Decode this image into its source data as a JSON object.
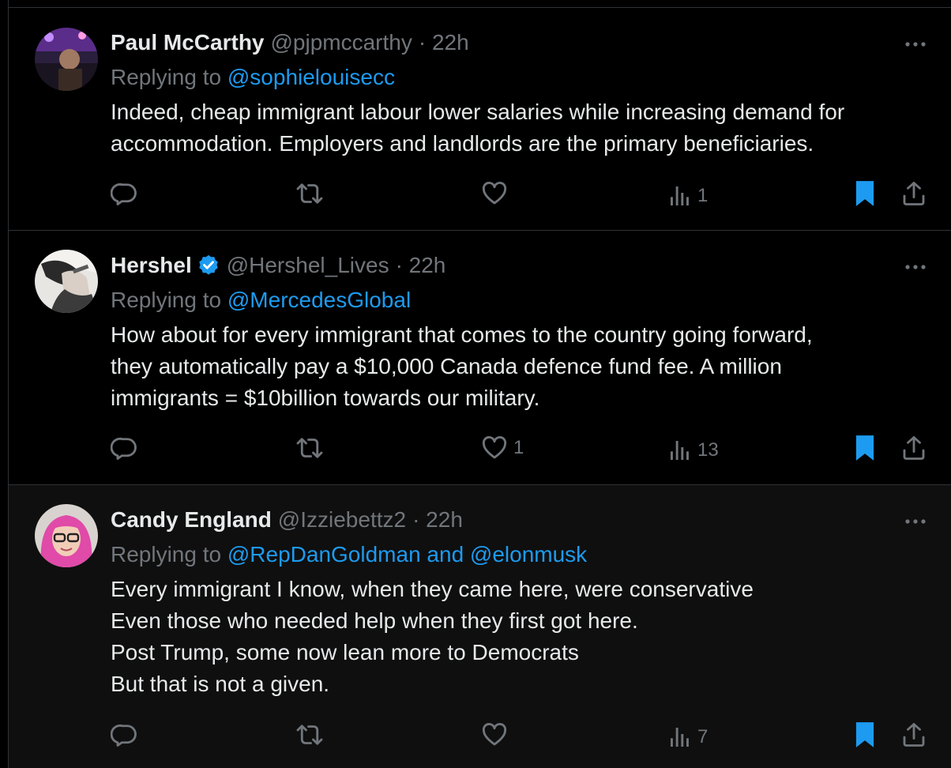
{
  "colors": {
    "background": "#000000",
    "accent": "#1d9bf0",
    "muted": "#71767b",
    "text": "#e7e9ea",
    "border": "#2f3336"
  },
  "tweets": [
    {
      "name": "Paul McCarthy",
      "handle": "@pjpmccarthy",
      "time": "· 22h",
      "replying_prefix": "Replying to",
      "replying_to": "@sophielouisecc",
      "lines": [
        "Indeed, cheap immigrant labour lower salaries while increasing demand for",
        "accommodation. Employers and landlords are the primary beneficiaries."
      ],
      "likes": "",
      "views": "1",
      "bookmarked": true
    },
    {
      "name": "Hershel",
      "verified": true,
      "handle": "@Hershel_Lives",
      "time": "· 22h",
      "replying_prefix": "Replying to",
      "replying_to": "@MercedesGlobal",
      "lines": [
        "How about for every immigrant that comes to the country going forward,",
        "they automatically pay a $10,000 Canada defence fund fee. A million",
        "immigrants = $10billion towards our military."
      ],
      "likes": "1",
      "views": "13",
      "bookmarked": true
    },
    {
      "name": "Candy England",
      "handle": "@Izziebettz2",
      "time": "· 22h",
      "replying_prefix": "Replying to",
      "replying_to": "@RepDanGoldman and @elonmusk",
      "lines": [
        "Every immigrant I know, when they came here, were conservative",
        "Even those who needed help when they first got here.",
        "Post Trump, some now lean more to Democrats",
        "But that is not a given."
      ],
      "likes": "",
      "views": "7",
      "bookmarked": true
    }
  ],
  "icons": [
    "reply-icon",
    "retweet-icon",
    "like-icon",
    "views-icon",
    "bookmark-icon",
    "share-icon",
    "more-icon",
    "verified-badge-icon"
  ]
}
